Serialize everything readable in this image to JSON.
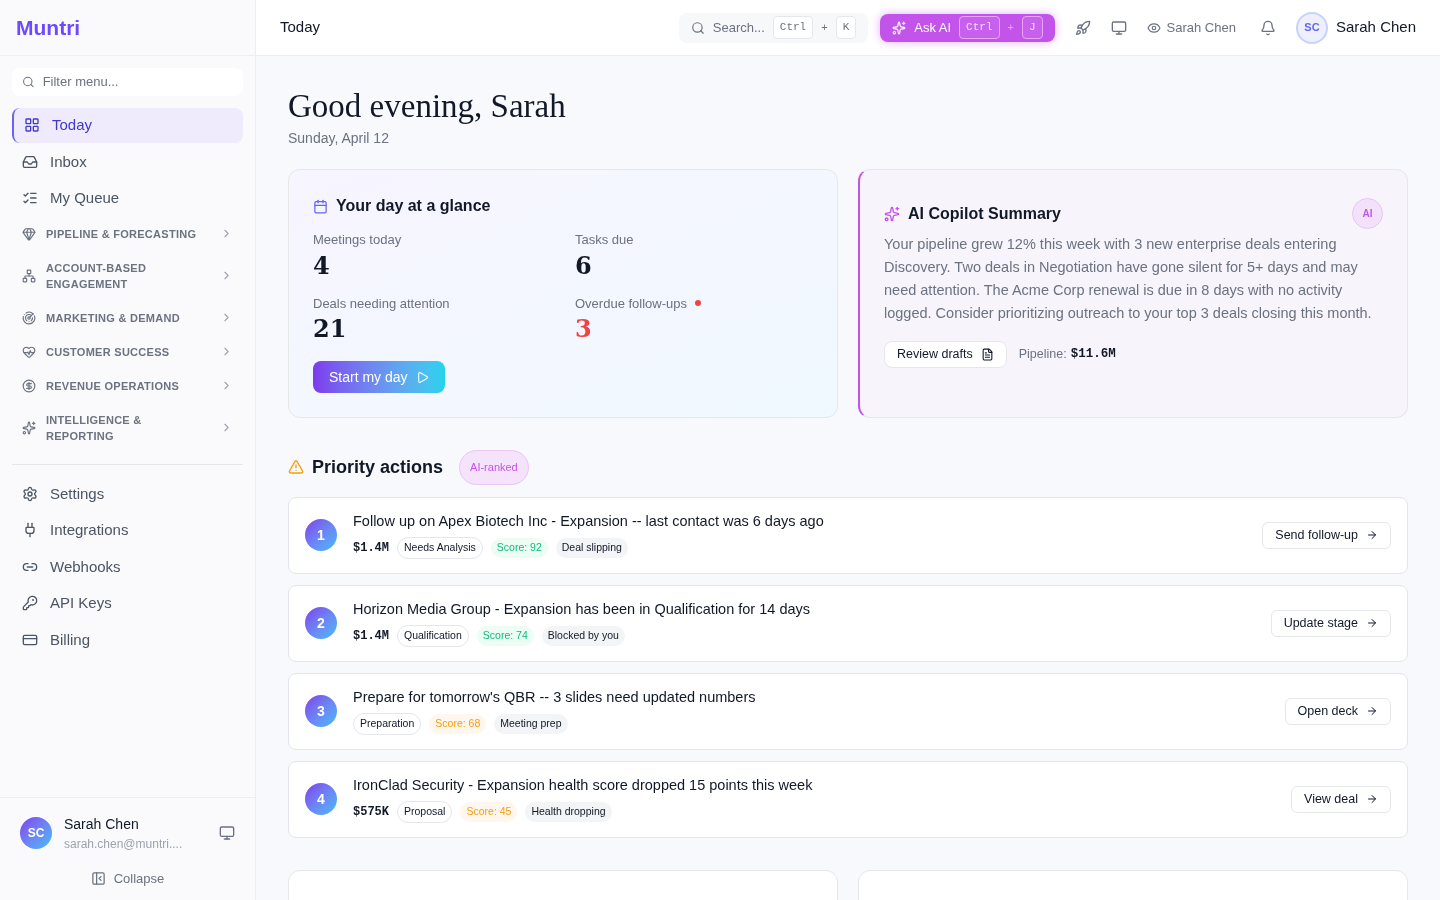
{
  "sidebar": {
    "logo": "Muntri",
    "filter": {
      "placeholder": "Filter menu..."
    },
    "nav": [
      {
        "label": "Today",
        "kind": "link",
        "selected": true
      },
      {
        "label": "Inbox",
        "kind": "link",
        "selected": false
      },
      {
        "label": "My Queue",
        "kind": "link",
        "selected": false
      },
      {
        "label": "PIPELINE & FORECASTING",
        "kind": "section",
        "selected": false
      },
      {
        "label": "ACCOUNT-BASED ENGAGEMENT",
        "kind": "section",
        "selected": false
      },
      {
        "label": "MARKETING & DEMAND",
        "kind": "section",
        "selected": false
      },
      {
        "label": "CUSTOMER SUCCESS",
        "kind": "section",
        "selected": false
      },
      {
        "label": "REVENUE OPERATIONS",
        "kind": "section",
        "selected": false
      },
      {
        "label": "INTELLIGENCE & REPORTING",
        "kind": "section",
        "selected": false
      }
    ],
    "secondary": [
      {
        "label": "Settings"
      },
      {
        "label": "Integrations"
      },
      {
        "label": "Webhooks"
      },
      {
        "label": "API Keys"
      },
      {
        "label": "Billing"
      }
    ],
    "user": {
      "initials": "SC",
      "name": "Sarah Chen",
      "email": "sarah.chen@muntri...."
    },
    "collapse": "Collapse"
  },
  "header": {
    "title": "Today",
    "search": {
      "placeholder": "Search...",
      "keys": [
        "Ctrl",
        "K"
      ],
      "plus": "+"
    },
    "ask_ai": {
      "label": "Ask AI",
      "keys": [
        "Ctrl",
        "J"
      ],
      "plus": "+"
    },
    "viewing_as": "Sarah Chen",
    "user": {
      "initials": "SC",
      "name": "Sarah Chen"
    }
  },
  "greeting": {
    "title": "Good evening, Sarah",
    "date": "Sunday, April 12"
  },
  "glance": {
    "title": "Your day at a glance",
    "stats": [
      {
        "label": "Meetings today",
        "value": "4",
        "alert": false
      },
      {
        "label": "Tasks due",
        "value": "6",
        "alert": false
      },
      {
        "label": "Deals needing attention",
        "value": "21",
        "alert": false
      },
      {
        "label": "Overdue follow-ups",
        "value": "3",
        "alert": true
      }
    ],
    "button": "Start my day"
  },
  "copilot": {
    "title": "AI Copilot Summary",
    "badge": "AI",
    "text": "Your pipeline grew 12% this week with 3 new enterprise deals entering Discovery. Two deals in Negotiation have gone silent for 5+ days and may need attention. The Acme Corp renewal is due in 8 days with no activity logged. Consider prioritizing outreach to your top 3 deals closing this month.",
    "button": "Review drafts",
    "pipeline_label": "Pipeline:",
    "pipeline_value": "$11.6M"
  },
  "priority": {
    "title": "Priority actions",
    "badge": "AI-ranked",
    "items": [
      {
        "rank": "1",
        "title": "Follow up on Apex Biotech Inc - Expansion -- last contact was 6 days ago",
        "amount": "$1.4M",
        "stage": "Needs Analysis",
        "score": "Score: 92",
        "kind": "good",
        "tag": "Deal slipping",
        "action": "Send follow-up"
      },
      {
        "rank": "2",
        "title": "Horizon Media Group - Expansion has been in Qualification for 14 days",
        "amount": "$1.4M",
        "stage": "Qualification",
        "score": "Score: 74",
        "kind": "good",
        "tag": "Blocked by you",
        "action": "Update stage"
      },
      {
        "rank": "3",
        "title": "Prepare for tomorrow's QBR -- 3 slides need updated numbers",
        "stage": "Preparation",
        "score": "Score: 68",
        "kind": "warn",
        "tag": "Meeting prep",
        "action": "Open deck"
      },
      {
        "rank": "4",
        "title": "IronClad Security - Expansion health score dropped 15 points this week",
        "amount": "$575K",
        "stage": "Proposal",
        "score": "Score: 45",
        "kind": "warn",
        "tag": "Health dropping",
        "action": "View deal"
      }
    ]
  }
}
